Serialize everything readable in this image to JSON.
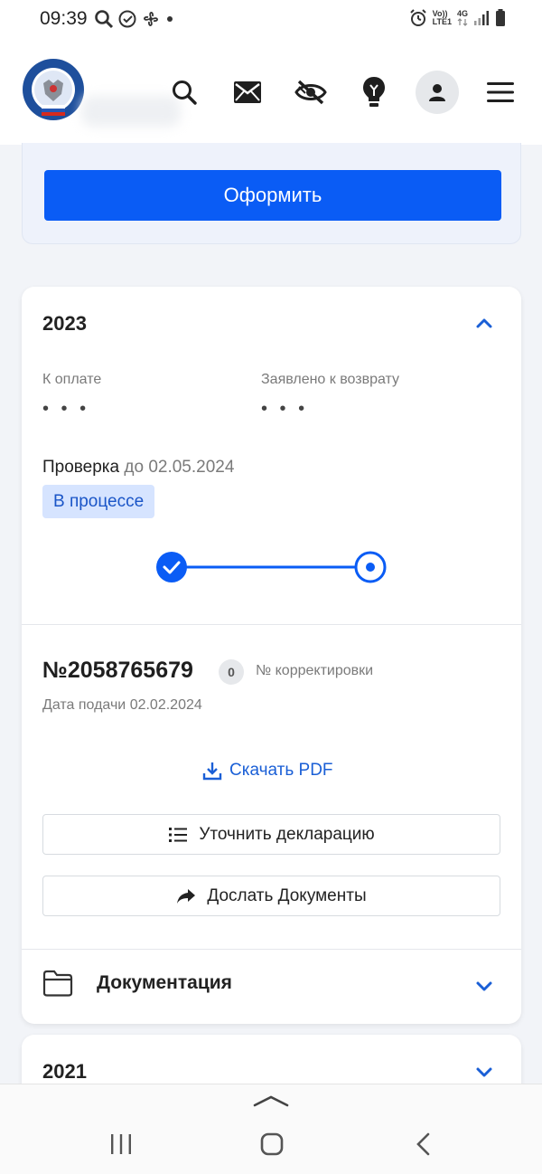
{
  "status_bar": {
    "time": "09:39",
    "volte": "Vo))",
    "lte": "LTE1",
    "network": "4G"
  },
  "header": {
    "icons": [
      "search-icon",
      "mail-icon",
      "eye-off-icon",
      "lightbulb-icon",
      "user-icon",
      "menu-icon"
    ]
  },
  "top_card": {
    "button_label": "Оформить"
  },
  "declaration_card": {
    "year": "2023",
    "to_pay_label": "К оплате",
    "to_pay_value": "• • •",
    "refund_label": "Заявлено к возврату",
    "refund_value": "• • •",
    "check_label": "Проверка",
    "check_deadline": "до 02.05.2024",
    "status_badge": "В процессе",
    "progress": {
      "steps_total": 2,
      "steps_done": 1
    },
    "number": "№2058765679",
    "correction_count": "0",
    "correction_label": "№ корректировки",
    "submit_date": "Дата подачи 02.02.2024",
    "pdf_link": "Скачать PDF",
    "refine_button": "Уточнить декларацию",
    "send_docs_button": "Дослать Документы",
    "docs_section": "Документация"
  },
  "second_card": {
    "year": "2021"
  },
  "colors": {
    "primary": "#0a5cf5",
    "link": "#1a5fd6",
    "badge_bg": "#d6e4ff",
    "badge_text": "#1a55c7"
  }
}
